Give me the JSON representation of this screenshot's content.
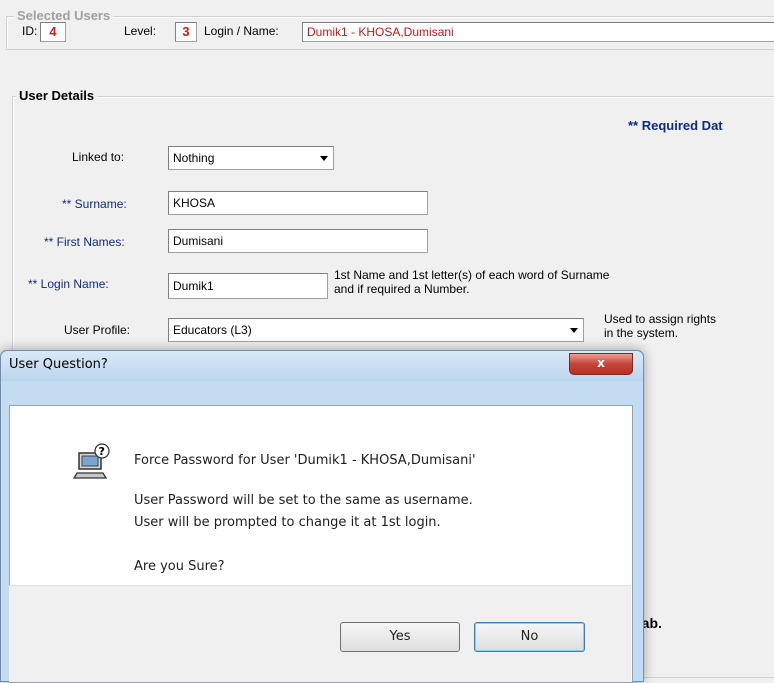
{
  "selected_users": {
    "legend": "Selected Users",
    "id_label": "ID:",
    "id_value": "4",
    "level_label": "Level:",
    "level_value": "3",
    "login_label": "Login / Name:",
    "login_value": "Dumik1 - KHOSA,Dumisani"
  },
  "user_details": {
    "legend": "User Details",
    "required_note": "** Required Dat",
    "linked_to_label": "Linked to:",
    "linked_to_value": "Nothing",
    "surname_label": "** Surname:",
    "surname_value": "KHOSA",
    "first_names_label": "** First Names:",
    "first_names_value": "Dumisani",
    "login_name_label": "** Login Name:",
    "login_name_value": "Dumik1",
    "login_hint_line1": "1st Name and 1st letter(s) of each word of Surname",
    "login_hint_line2": "and if required a Number.",
    "user_profile_label": "User Profile:",
    "user_profile_value": "Educators (L3)",
    "profile_hint_line1": "Used to assign rights",
    "profile_hint_line2": "in the system.",
    "partial_tab_text": "tab."
  },
  "dialog": {
    "title": "User Question?",
    "close_label": "x",
    "line1": "Force Password for User 'Dumik1 - KHOSA,Dumisani'",
    "line2": "User Password will be set to the same as username.",
    "line3": "User will be prompted to change it at 1st login.",
    "line4": "Are you Sure?",
    "yes_label": "Yes",
    "no_label": "No",
    "icon": "computer-question-icon"
  }
}
